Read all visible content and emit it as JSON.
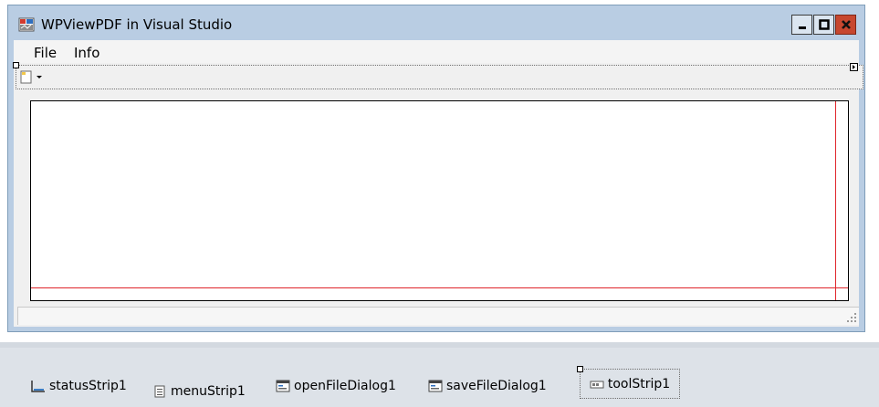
{
  "window": {
    "title": "WPViewPDF in Visual Studio",
    "icon": "wpviewpdf-app-icon",
    "controls": [
      "minimize-icon",
      "maximize-icon",
      "close-icon"
    ]
  },
  "menu": {
    "items": [
      {
        "label": "File"
      },
      {
        "label": "Info"
      }
    ]
  },
  "toolstrip": {
    "items": [
      {
        "icon": "new-document-dropdown-icon"
      }
    ],
    "overflow_icon": "chevron-right-icon"
  },
  "tray": {
    "components": [
      {
        "label": "statusStrip1",
        "icon": "statusstrip-icon"
      },
      {
        "label": "menuStrip1",
        "icon": "menustrip-icon"
      },
      {
        "label": "openFileDialog1",
        "icon": "dialog-icon"
      },
      {
        "label": "saveFileDialog1",
        "icon": "dialog-icon"
      },
      {
        "label": "toolStrip1",
        "icon": "toolstrip-icon",
        "selected": true
      }
    ]
  },
  "colors": {
    "window_frame": "#b9cde3",
    "close_button": "#c7472f",
    "guide_line": "#e0262b",
    "tray_background": "#dde2e8"
  }
}
